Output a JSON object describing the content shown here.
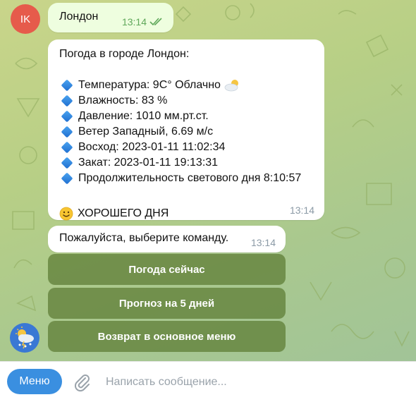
{
  "user": {
    "avatar_initials": "IK",
    "avatar_color": "#e65b4b",
    "message_text": "Лондон",
    "message_time": "13:14"
  },
  "weather_message": {
    "header": "Погода в городе Лондон:",
    "lines": [
      "Температура: 9С° Облачно",
      "Влажность: 83 %",
      "Давление: 1010 мм.рт.ст.",
      "Ветер Западный, 6.69 м/с",
      "Восход: 2023-01-11 11:02:34",
      "Закат: 2023-01-11 19:13:31",
      "Продолжительность светового дня 8:10:57"
    ],
    "footer": "ХОРОШЕГО ДНЯ",
    "time": "13:14"
  },
  "prompt_message": {
    "text": "Пожалуйста, выберите команду.",
    "time": "13:14"
  },
  "keyboard": {
    "buttons": [
      "Погода сейчас",
      "Прогноз на 5 дней",
      "Возврат в основное меню"
    ]
  },
  "input_bar": {
    "menu_label": "Меню",
    "placeholder": "Написать сообщение..."
  },
  "colors": {
    "accent": "#3a8fe0",
    "keyboard_button": "#62803a",
    "read_check": "#5fa85a"
  }
}
